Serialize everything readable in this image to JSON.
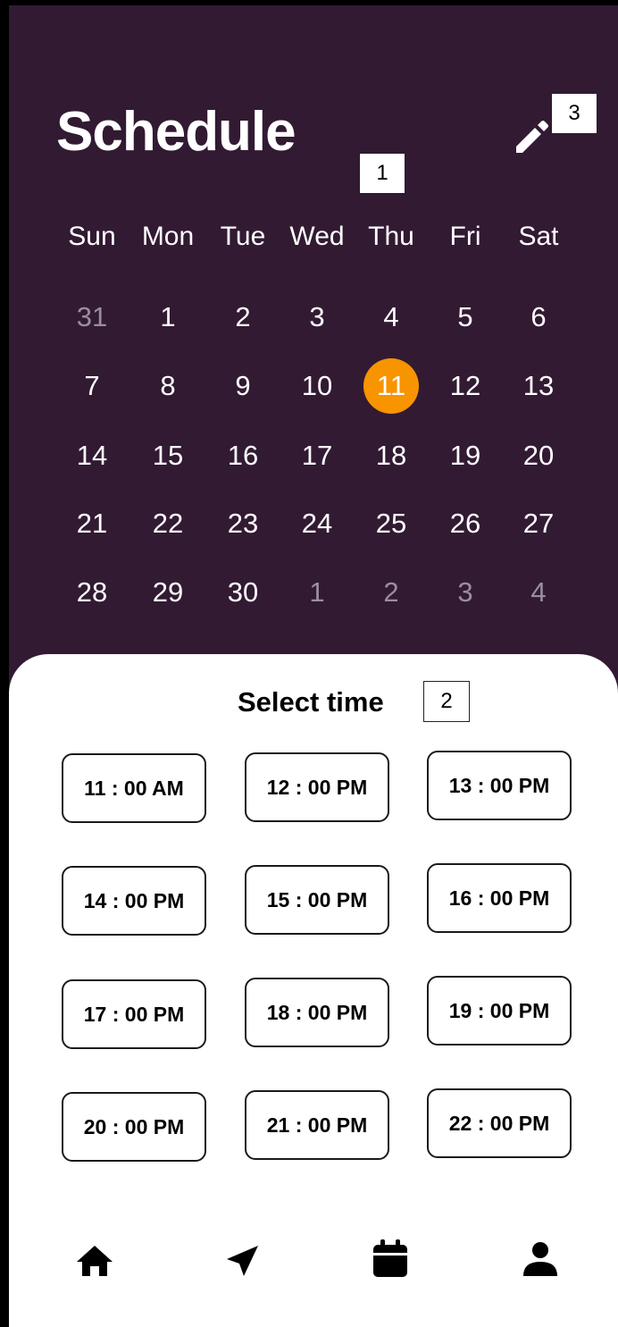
{
  "header": {
    "title": "Schedule",
    "edit_icon": "pencil-icon"
  },
  "markers": [
    "1",
    "2",
    "3"
  ],
  "calendar": {
    "weekdays": [
      "Sun",
      "Mon",
      "Tue",
      "Wed",
      "Thu",
      "Fri",
      "Sat"
    ],
    "selected_day": "11",
    "selected_color": "#f79400",
    "weeks": [
      [
        "31",
        "1",
        "2",
        "3",
        "4",
        "5",
        "6"
      ],
      [
        "7",
        "8",
        "9",
        "10",
        "11",
        "12",
        "13"
      ],
      [
        "14",
        "15",
        "16",
        "17",
        "18",
        "19",
        "20"
      ],
      [
        "21",
        "22",
        "23",
        "24",
        "25",
        "26",
        "27"
      ],
      [
        "28",
        "29",
        "30",
        "1",
        "2",
        "3",
        "4"
      ]
    ]
  },
  "time_picker": {
    "title": "Select time",
    "slots": [
      "11 : 00 AM",
      "12 : 00 PM",
      "13 : 00 PM",
      "14 : 00 PM",
      "15 : 00 PM",
      "16 : 00 PM",
      "17 : 00 PM",
      "18 : 00 PM",
      "19 : 00 PM",
      "20 : 00 PM",
      "21 : 00 PM",
      "22 : 00 PM"
    ]
  },
  "bottom_nav": {
    "items": [
      "home-icon",
      "send-icon",
      "calendar-icon",
      "profile-icon"
    ]
  },
  "colors": {
    "header_background": "#321a33",
    "accent": "#f79400"
  }
}
